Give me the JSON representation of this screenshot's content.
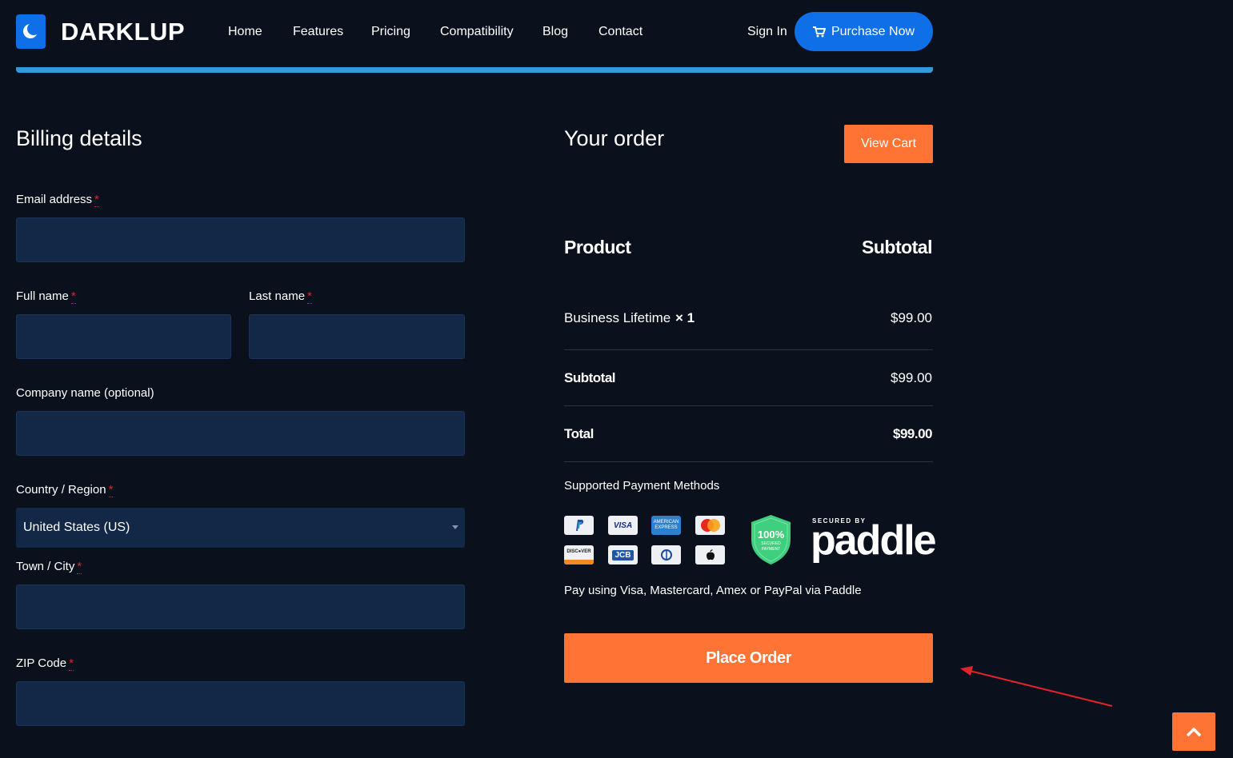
{
  "brand": {
    "name": "DARKLUP"
  },
  "nav": {
    "items": [
      "Home",
      "Features",
      "Pricing",
      "Compatibility",
      "Blog",
      "Contact"
    ],
    "sign_in": "Sign In",
    "purchase": "Purchase Now"
  },
  "billing": {
    "title": "Billing details",
    "required_mark": "*",
    "email_label": "Email address",
    "full_name_label": "Full name",
    "last_name_label": "Last name",
    "company_label": "Company name (optional)",
    "country_label": "Country / Region",
    "country_value": "United States (US)",
    "town_label": "Town / City",
    "zip_label": "ZIP Code"
  },
  "order": {
    "title": "Your order",
    "view_cart": "View Cart",
    "col_product": "Product",
    "col_subtotal": "Subtotal",
    "item_name": "Business Lifetime",
    "item_qty": "× 1",
    "item_price": "$99.00",
    "subtotal_label": "Subtotal",
    "subtotal_value": "$99.00",
    "total_label": "Total",
    "total_value": "$99.00",
    "payment_heading": "Supported Payment Methods",
    "payment_note": "Pay using Visa, Mastercard, Amex or PayPal via Paddle",
    "place_order": "Place Order"
  },
  "payment_logos": {
    "visa": "VISA",
    "amex_top": "AMERICAN",
    "amex_bottom": "EXPRESS",
    "discover": "DISC●VER",
    "jcb": "JCB",
    "badge_percent": "100%",
    "badge_line1": "SECURED",
    "badge_line2": "PAYMENT",
    "paddle_small": "SECURED BY",
    "paddle_word": "paddle"
  },
  "colors": {
    "background": "#0a101c",
    "primary_blue": "#0f6fe6",
    "accent_orange": "#ff7335",
    "input_bg": "#132747",
    "required_red": "#e3232c",
    "annotation_arrow": "#e3232c"
  },
  "icons": [
    "moon-icon",
    "cart-icon",
    "chevron-down-icon",
    "chevron-up-icon",
    "shield-icon",
    "arrow-annotation-icon"
  ]
}
